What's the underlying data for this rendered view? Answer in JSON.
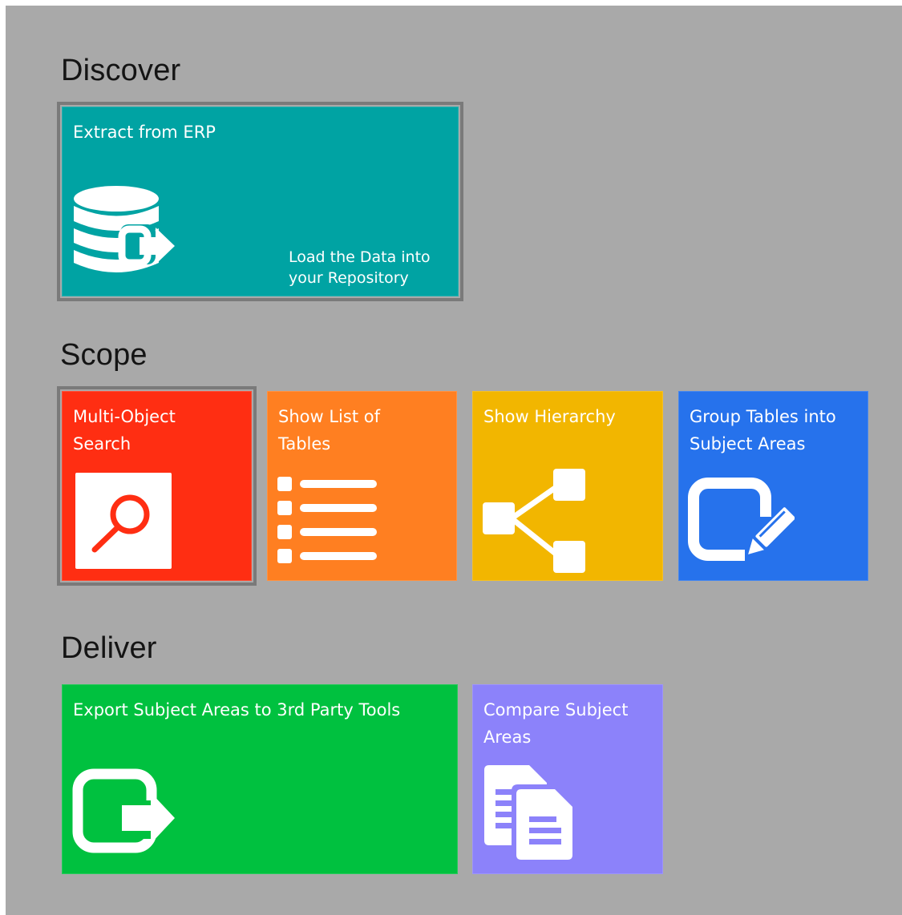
{
  "sections": {
    "discover": {
      "title": "Discover"
    },
    "scope": {
      "title": "Scope"
    },
    "deliver": {
      "title": "Deliver"
    }
  },
  "tiles": {
    "extract": {
      "label": "Extract from ERP",
      "sublabel": "Load the Data into\nyour Repository",
      "color": "#00a3a3",
      "icon": "database-export-icon"
    },
    "multi_object_search": {
      "label": "Multi-Object\nSearch",
      "color": "#ff2e12",
      "icon": "search-icon"
    },
    "show_list_of_tables": {
      "label": "Show List of\nTables",
      "color": "#ff7f21",
      "icon": "list-icon"
    },
    "show_hierarchy": {
      "label": "Show Hierarchy",
      "color": "#f2b600",
      "icon": "hierarchy-icon"
    },
    "group_tables": {
      "label": "Group Tables into\nSubject Areas",
      "color": "#2672ec",
      "icon": "edit-icon"
    },
    "export_subject_areas": {
      "label": "Export Subject Areas to 3rd Party Tools",
      "color": "#00c13f",
      "icon": "export-icon"
    },
    "compare_subject_areas": {
      "label": "Compare Subject\nAreas",
      "color": "#8c82fa",
      "icon": "compare-documents-icon"
    }
  }
}
